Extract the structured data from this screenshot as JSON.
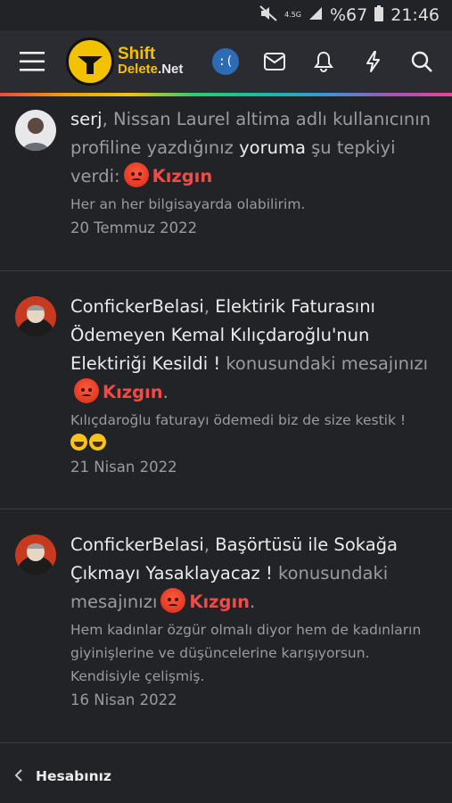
{
  "status": {
    "network": "4.5G",
    "battery": "%67",
    "time": "21:46"
  },
  "header": {
    "logo_line1": "Shift",
    "logo_line2a": "Delete",
    "logo_line2b": ".Net",
    "user_avatar_text": ":("
  },
  "feed": [
    {
      "user": "serj",
      "text_before": ", Nissan Laurel altima adlı kullanıcının profiline yazdığınız ",
      "link": "yoruma",
      "text_after": " şu tepkiyi verdi:",
      "reaction": "Kızgın",
      "tail": "",
      "snippet": "Her an her bilgisayarda olabilirim.",
      "date": "20 Temmuz 2022"
    },
    {
      "user": "ConfickerBelasi",
      "text_before": ", ",
      "link": "Elektirik Faturasını Ödemeyen Kemal Kılıçdaroğlu'nun Elektiriği Kesildi !",
      "text_after": " konusundaki mesajınızı",
      "reaction": "Kızgın",
      "tail": ".",
      "snippet": "Kılıçdaroğlu faturayı ödemedi biz de size kestik !",
      "date": "21 Nisan 2022"
    },
    {
      "user": "ConfickerBelasi",
      "text_before": ", ",
      "link": "Başörtüsü ile Sokağa Çıkmayı Yasaklayacaz !",
      "text_after": " konusundaki mesajınızı",
      "reaction": "Kızgın",
      "tail": ".",
      "snippet": "Hem kadınlar özgür olmalı diyor hem de kadınların giyinişlerine ve düşüncelerine karışıyorsun. Kendisiyle çelişmiş.",
      "date": "16 Nisan 2022"
    }
  ],
  "footer": {
    "label": "Hesabınız"
  }
}
